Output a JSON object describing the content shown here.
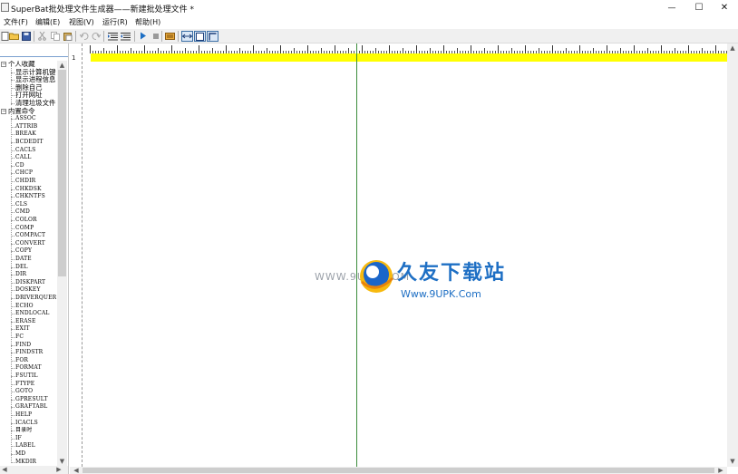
{
  "window": {
    "title": "SuperBat批处理文件生成器——新建批处理文件 *",
    "minimize_glyph": "—",
    "maximize_glyph": "☐",
    "close_glyph": "✕"
  },
  "menu": [
    {
      "label": "文件(F)"
    },
    {
      "label": "编辑(E)"
    },
    {
      "label": "视图(V)"
    },
    {
      "label": "运行(R)"
    },
    {
      "label": "帮助(H)"
    }
  ],
  "toolbar": {
    "buttons": [
      "new-file-icon",
      "open-folder-icon",
      "save-icon",
      "cut-icon",
      "copy-icon",
      "paste-icon",
      "undo-icon",
      "redo-icon",
      "indent-icon",
      "outdent-icon",
      "run-icon",
      "stop-icon",
      "batch-icon",
      "wrap-icon",
      "grid-icon",
      "corner-icon"
    ]
  },
  "tree": {
    "group_personal": "个人收藏",
    "personal_items": [
      "显示计算机键位",
      "显示进程信息",
      "删除自己",
      "打开网址",
      "清理垃圾文件"
    ],
    "group_builtin": "内置命令",
    "commands": [
      "ASSOC",
      "ATTRIB",
      "BREAK",
      "BCDEDIT",
      "CACLS",
      "CALL",
      "CD",
      "CHCP",
      "CHDIR",
      "CHKDSK",
      "CHKNTFS",
      "CLS",
      "CMD",
      "COLOR",
      "COMP",
      "COMPACT",
      "CONVERT",
      "COPY",
      "DATE",
      "DEL",
      "DIR",
      "DISKPART",
      "DOSKEY",
      "DRIVERQUERY",
      "ECHO",
      "ENDLOCAL",
      "ERASE",
      "EXIT",
      "FC",
      "FIND",
      "FINDSTR",
      "FOR",
      "FORMAT",
      "FSUTIL",
      "FTYPE",
      "GOTO",
      "GPRESULT",
      "GRAFTABL",
      "HELP",
      "ICACLS",
      "目录时",
      "IF",
      "LABEL",
      "MD",
      "MKDIR"
    ]
  },
  "editor": {
    "line_number": "1",
    "highlight_color": "#ffff00",
    "guide_color": "#3a8c3a"
  },
  "watermark": {
    "url_small": "WWW.9UPK.COM",
    "brand": "久友下载站",
    "url_large": "Www.9UPK.Com"
  },
  "scroll_arrows": {
    "up": "▲",
    "down": "▼",
    "left": "◀",
    "right": "▶"
  }
}
